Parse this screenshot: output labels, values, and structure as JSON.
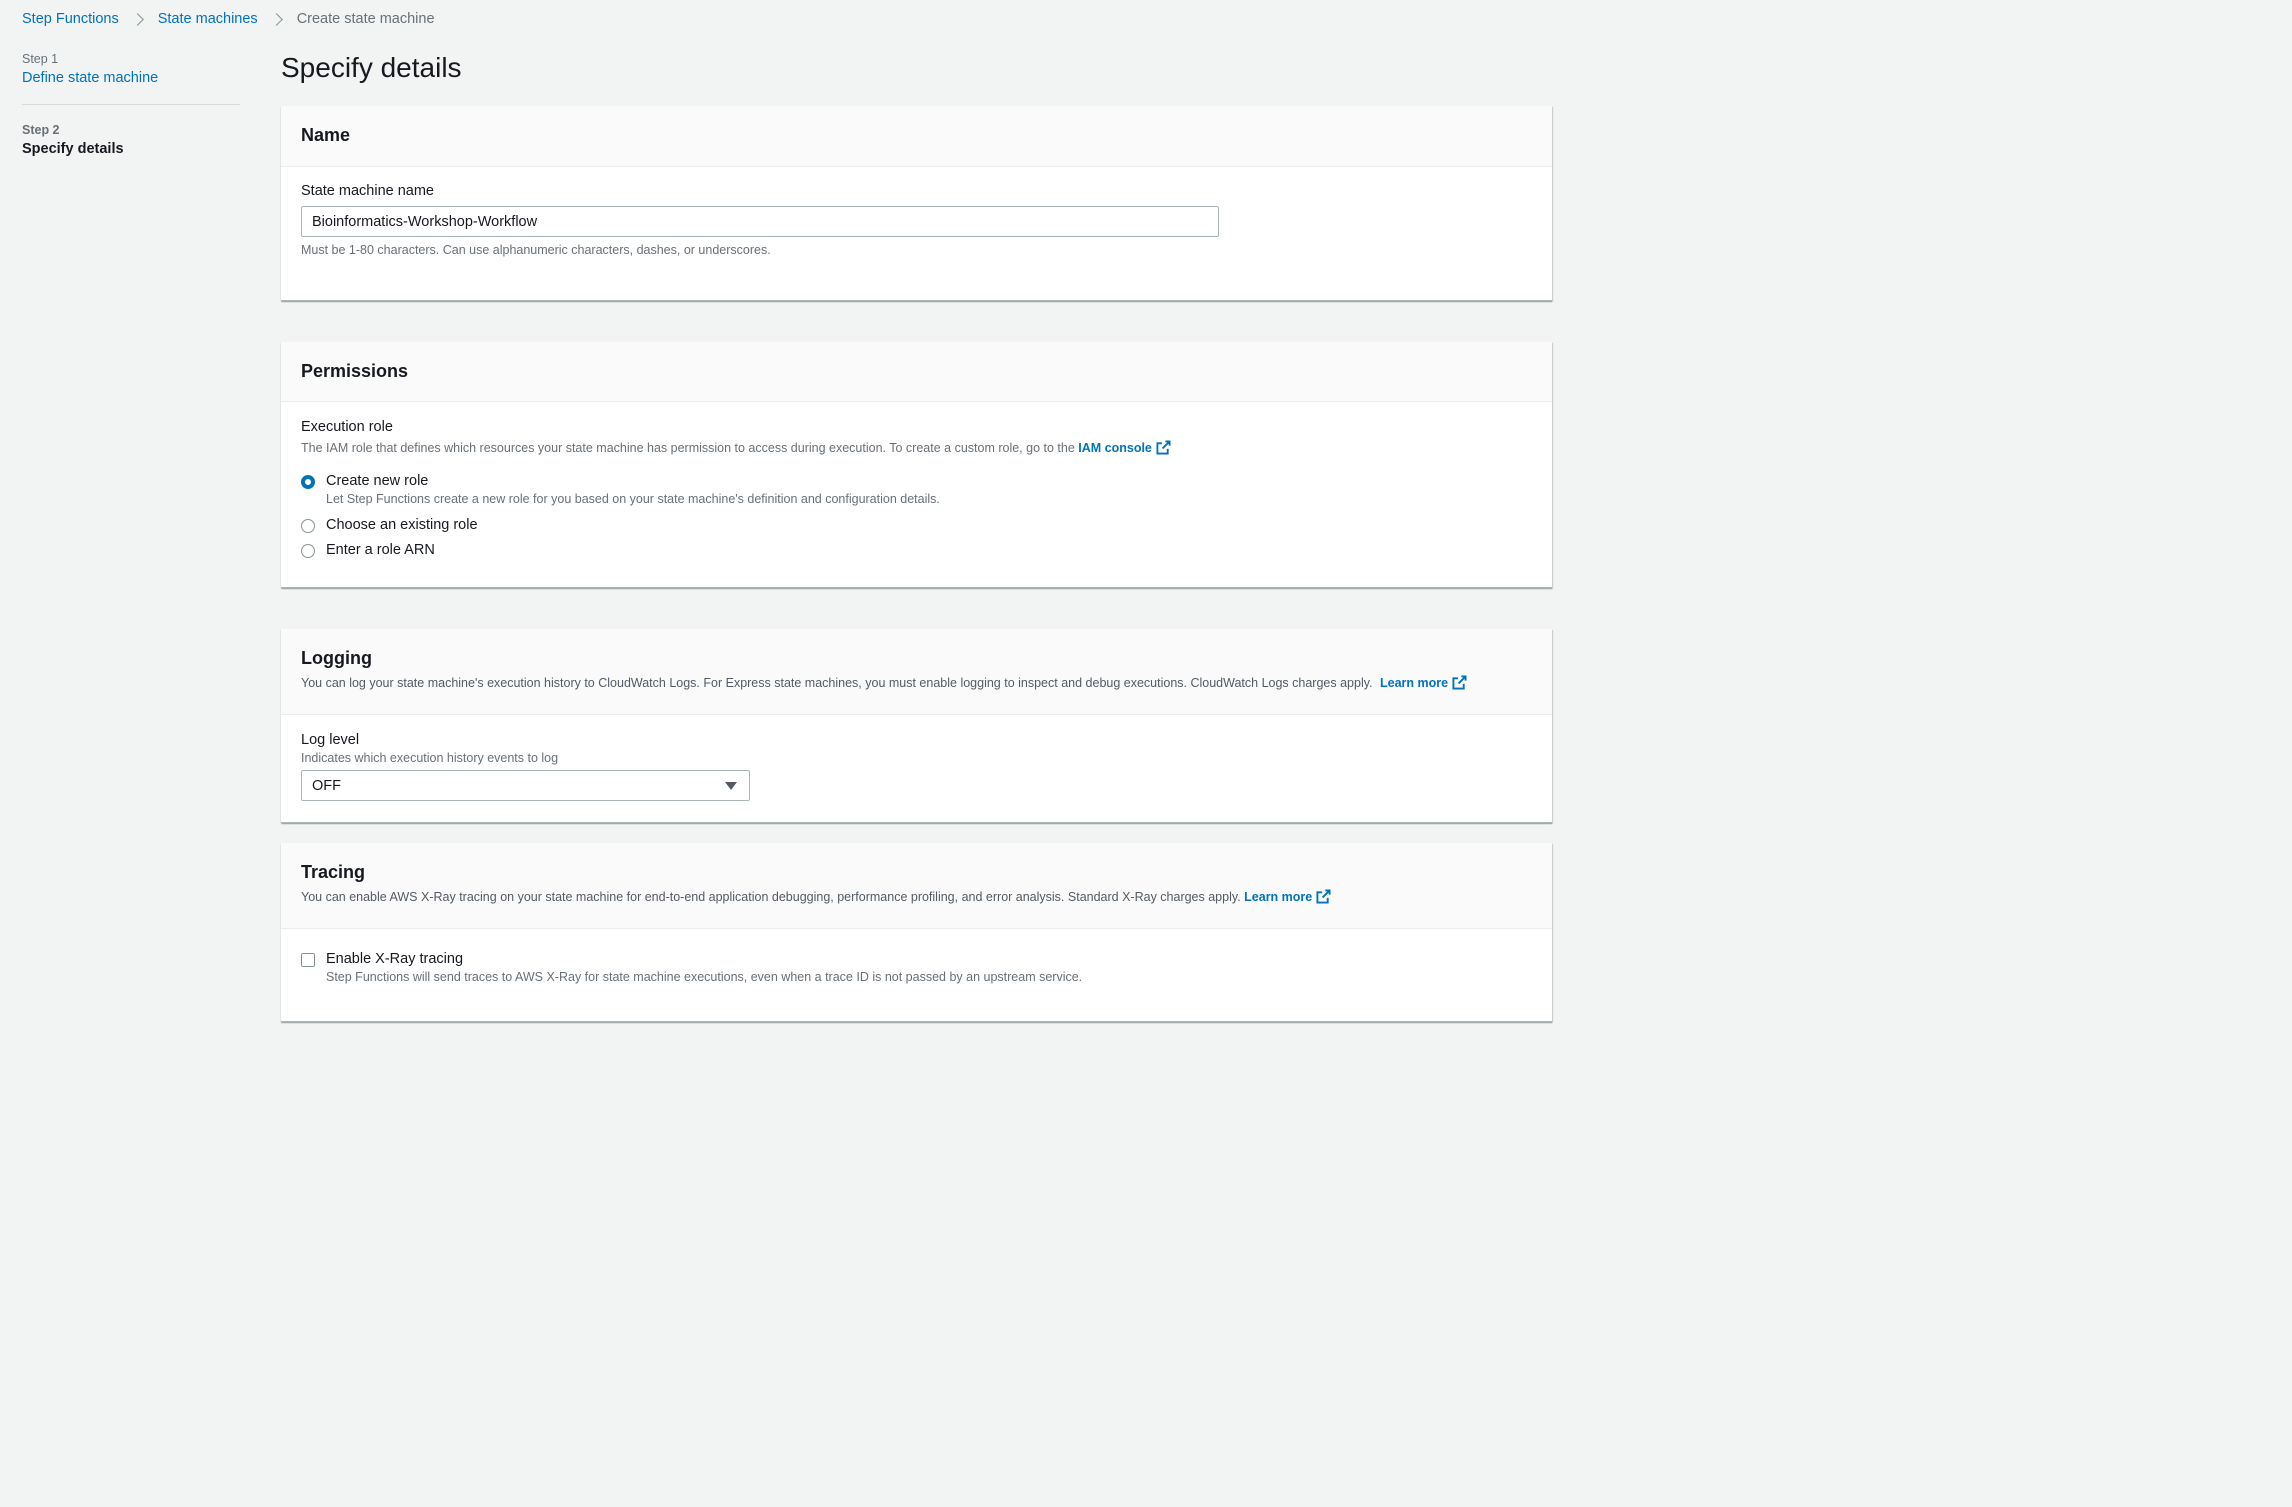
{
  "breadcrumb": {
    "items": [
      "Step Functions",
      "State machines"
    ],
    "current": "Create state machine"
  },
  "sidenav": {
    "step1": {
      "num": "Step 1",
      "label": "Define state machine"
    },
    "step2": {
      "num": "Step 2",
      "label": "Specify details"
    }
  },
  "page_title": "Specify details",
  "name_panel": {
    "title": "Name",
    "field_label": "State machine name",
    "field_value": "Bioinformatics-Workshop-Workflow",
    "hint": "Must be 1-80 characters. Can use alphanumeric characters, dashes, or underscores."
  },
  "permissions_panel": {
    "title": "Permissions",
    "role_label": "Execution role",
    "role_desc": "The IAM role that defines which resources your state machine has permission to access during execution. To create a custom role, go to the",
    "iam_link": "IAM console",
    "options": [
      {
        "label": "Create new role",
        "desc": "Let Step Functions create a new role for you based on your state machine's definition and configuration details.",
        "checked": true
      },
      {
        "label": "Choose an existing role",
        "checked": false
      },
      {
        "label": "Enter a role ARN",
        "checked": false
      }
    ]
  },
  "logging_panel": {
    "title": "Logging",
    "desc": "You can log your state machine's execution history to CloudWatch Logs. For Express state machines, you must enable logging to inspect and debug executions. CloudWatch Logs charges apply.",
    "learn_more": "Learn more",
    "log_level_label": "Log level",
    "log_level_desc": "Indicates which execution history events to log",
    "log_level_value": "OFF"
  },
  "tracing_panel": {
    "title": "Tracing",
    "desc": "You can enable AWS X-Ray tracing on your state machine for end-to-end application debugging, performance profiling, and error analysis. Standard X-Ray charges apply.",
    "learn_more": "Learn more",
    "checkbox_label": "Enable X-Ray tracing",
    "checkbox_desc": "Step Functions will send traces to AWS X-Ray for state machine executions, even when a trace ID is not passed by an upstream service.",
    "checked": false
  },
  "colors": {
    "link": "#0073bb",
    "background": "#f2f3f3",
    "panel_header": "#fafafa",
    "text": "#16191f",
    "muted": "#687078"
  },
  "icons": [
    "chevron-right-icon",
    "external-link-icon",
    "caret-down-icon"
  ]
}
